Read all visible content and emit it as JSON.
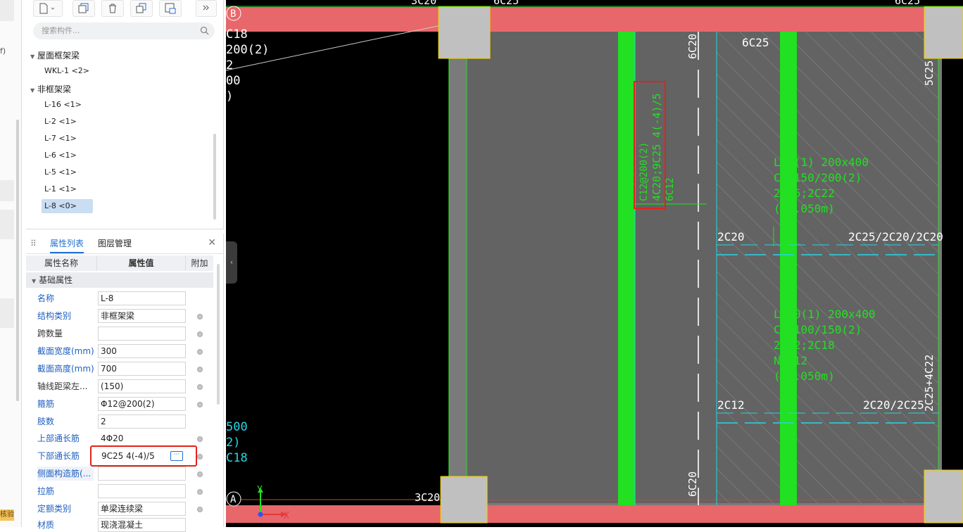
{
  "toolbar": {
    "buttons": [
      "new-icon",
      "copy-icon",
      "delete-icon",
      "duplicate-icon",
      "save-floor-icon",
      "more-icon"
    ]
  },
  "search": {
    "placeholder": "搜索构件..."
  },
  "tree": {
    "group1": "屋面框架梁",
    "group1_items": [
      "WKL-1 <2>"
    ],
    "group2": "非框架梁",
    "group2_items": [
      "L-16 <1>",
      "L-2 <1>",
      "L-7 <1>",
      "L-6 <1>",
      "L-5 <1>",
      "L-1 <1>",
      "L-8 <0>"
    ],
    "selected": "L-8 <0>"
  },
  "props": {
    "tab_active": "属性列表",
    "tab_other": "图层管理",
    "col_name": "属性名称",
    "col_value": "属性值",
    "col_extra": "附加",
    "section": "基础属性",
    "rows": [
      {
        "label": "名称",
        "value": "L-8"
      },
      {
        "label": "结构类别",
        "value": "非框架梁"
      },
      {
        "label": "跨数量",
        "value": ""
      },
      {
        "label": "截面宽度(mm)",
        "value": "300"
      },
      {
        "label": "截面高度(mm)",
        "value": "700"
      },
      {
        "label": "轴线距梁左...",
        "value": "(150)"
      },
      {
        "label": "箍筋",
        "value": "Φ12@200(2)"
      },
      {
        "label": "肢数",
        "value": "2"
      },
      {
        "label": "上部通长筋",
        "value": "4Φ20"
      },
      {
        "label": "下部通长筋",
        "value": "9C25 4(-4)/5"
      },
      {
        "label": "侧面构造筋(...",
        "value": ""
      },
      {
        "label": "拉筋",
        "value": ""
      },
      {
        "label": "定额类别",
        "value": "单梁连续梁"
      },
      {
        "label": "材质",
        "value": "现浇混凝土"
      }
    ]
  },
  "leftstrip": {
    "paren": "f)",
    "tag": "核验"
  },
  "cad": {
    "axis_b": "B",
    "axis_a": "A",
    "axis_x": "X",
    "axis_y": "Y",
    "labels": {
      "t_3c20_top": "3C20",
      "t_6c25_top": "6C25",
      "t_6c25_topr": "6C25",
      "t_c18": "C18",
      "t_200_2": "200(2)",
      "t_2": "2",
      "t_00": "00",
      "t_paren": ")",
      "t_6c20_v1": "6C20",
      "t_6c25_mid": "6C25",
      "t_5c25_v": "5C25",
      "t_bottom_main": "4C20;9C25 4(-4)/5",
      "t_stir1": "C12@200(2)",
      "t_sect1": "L-8(1) 300x700",
      "t_6c12": "6C12",
      "t_l_a": "L-9(1) 200x400",
      "t_c_a": "C8@150/200(2)",
      "t_2c_a": "2C25;2C22",
      "t_h_a": "(-0.050m)",
      "t_2c20": "2C20",
      "t_2c25_2c20": "2C25/2C20/2C20",
      "t_l_b": "L-10(1) 200x400",
      "t_c_b": "C8@100/150(2)",
      "t_2c_b": "2C22;2C18",
      "t_n_b": "N2C12",
      "t_h_b": "(-0.050m)",
      "t_2c12": "2C12",
      "t_2c20_2c25": "2C20/2C25",
      "t_2c25_4c22": "2C25+4C22",
      "t_500": "500",
      "t_2p": "2)",
      "t_c18b": "C18",
      "t_3c20_bot": "3C20",
      "t_6c20_v2": "6C20"
    }
  },
  "colors": {
    "beam_red": "#e8676a",
    "rebar_green": "#22e022",
    "cad_cyan": "#26d6e6",
    "slab_gray": "#636363",
    "column_gray": "#c0c0c0",
    "highlight_red": "#e2231a",
    "accent_blue": "#1f6fd1"
  }
}
